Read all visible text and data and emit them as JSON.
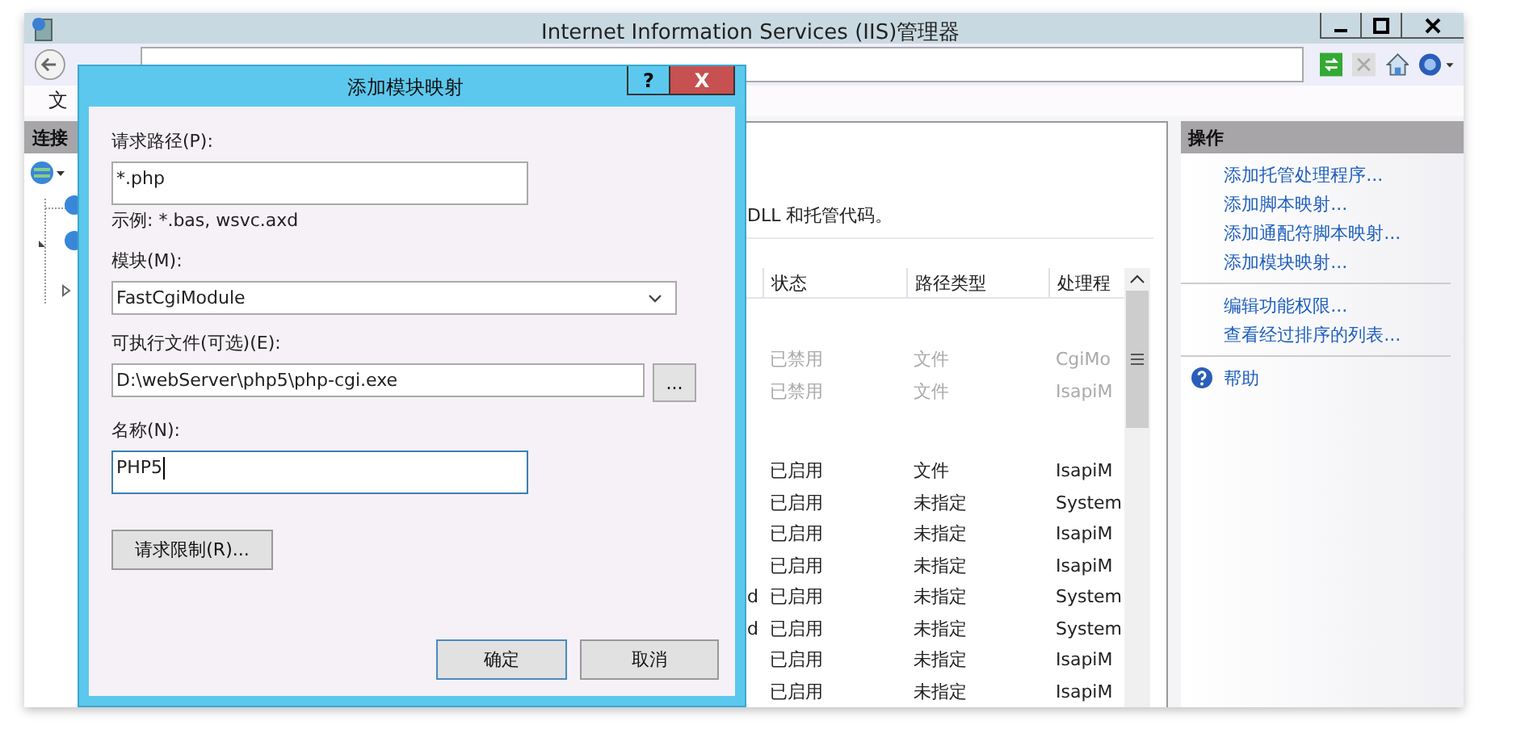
{
  "window": {
    "title": "Internet Information Services (IIS)管理器"
  },
  "menu_bar": [
    {
      "label": "文"
    }
  ],
  "connections_pane": {
    "title": "连接"
  },
  "feature_pane": {
    "description": "DLL 和托管代码。",
    "table": {
      "columns": [
        "状态",
        "路径类型",
        "处理程"
      ],
      "groups": [
        {
          "rows": [
            {
              "status": "已禁用",
              "path_type": "文件",
              "handler": "CgiMo",
              "disabled": true
            },
            {
              "status": "已禁用",
              "path_type": "文件",
              "handler": "IsapiM",
              "disabled": true
            }
          ]
        },
        {
          "rows": [
            {
              "status": "已启用",
              "path_type": "文件",
              "handler": "IsapiM",
              "disabled": false
            },
            {
              "status": "已启用",
              "path_type": "未指定",
              "handler": "System",
              "disabled": false
            },
            {
              "status": "已启用",
              "path_type": "未指定",
              "handler": "IsapiM",
              "disabled": false
            },
            {
              "status": "已启用",
              "path_type": "未指定",
              "handler": "IsapiM",
              "disabled": false
            },
            {
              "column_1": "d",
              "status": "已启用",
              "path_type": "未指定",
              "handler": "System",
              "disabled": false
            },
            {
              "column_1": "d",
              "status": "已启用",
              "path_type": "未指定",
              "handler": "System",
              "disabled": false
            },
            {
              "status": "已启用",
              "path_type": "未指定",
              "handler": "IsapiM",
              "disabled": false
            },
            {
              "status": "已启用",
              "path_type": "未指定",
              "handler": "IsapiM",
              "disabled": false
            }
          ]
        }
      ]
    }
  },
  "actions_pane": {
    "title": "操作",
    "groups": [
      {
        "links": [
          {
            "label": "添加托管处理程序...",
            "kind": "link"
          },
          {
            "label": "添加脚本映射...",
            "kind": "link"
          },
          {
            "label": "添加通配符脚本映射...",
            "kind": "link"
          },
          {
            "label": "添加模块映射...",
            "kind": "link"
          }
        ]
      },
      {
        "links": [
          {
            "label": "编辑功能权限...",
            "kind": "link"
          },
          {
            "label": "查看经过排序的列表...",
            "kind": "link"
          }
        ]
      },
      {
        "links": [
          {
            "label": "帮助",
            "kind": "help"
          }
        ]
      }
    ]
  },
  "dialog": {
    "title": "添加模块映射",
    "help_button": "?",
    "close_button": "X",
    "fields": [
      {
        "kind": "text",
        "label": "请求路径(P):",
        "value": "*.php",
        "hint": "示例: *.bas, wsvc.axd",
        "focused": false
      },
      {
        "kind": "select",
        "label": "模块(M):",
        "value": "FastCgiModule",
        "focused": false
      },
      {
        "kind": "browse",
        "label": "可执行文件(可选)(E):",
        "value": "D:\\webServer\\php5\\php-cgi.exe",
        "button": "...",
        "focused": false
      },
      {
        "kind": "text",
        "label": "名称(N):",
        "value": "PHP5",
        "focused": true
      }
    ],
    "restrictions_button": "请求限制(R)...",
    "ok_button": "确定",
    "cancel_button": "取消"
  }
}
